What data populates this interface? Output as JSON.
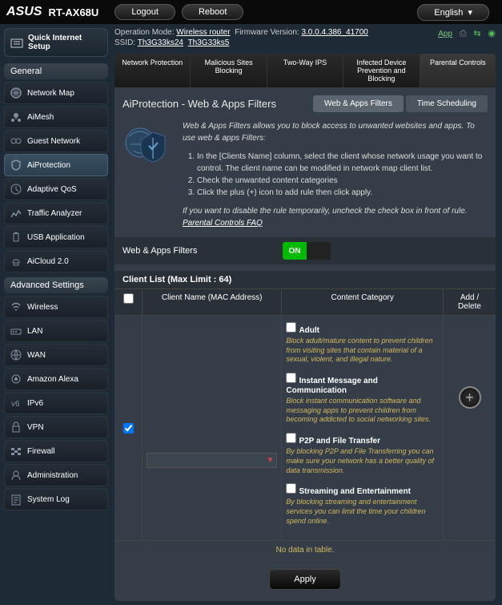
{
  "brand": "ASUS",
  "model": "RT-AX68U",
  "top_buttons": {
    "logout": "Logout",
    "reboot": "Reboot",
    "language": "English"
  },
  "info": {
    "op_mode_label": "Operation Mode:",
    "op_mode_value": "Wireless router",
    "fw_label": "Firmware Version:",
    "fw_value": "3.0.0.4.386_41700",
    "ssid_label": "SSID:",
    "ssid1": "Th3G33ks24",
    "ssid2": "Th3G33ks5",
    "app": "App"
  },
  "qis": "Quick Internet Setup",
  "sections": {
    "general": "General",
    "advanced": "Advanced Settings"
  },
  "menu_general": [
    "Network Map",
    "AiMesh",
    "Guest Network",
    "AiProtection",
    "Adaptive QoS",
    "Traffic Analyzer",
    "USB Application",
    "AiCloud 2.0"
  ],
  "menu_advanced": [
    "Wireless",
    "LAN",
    "WAN",
    "Amazon Alexa",
    "IPv6",
    "VPN",
    "Firewall",
    "Administration",
    "System Log"
  ],
  "tabs": [
    "Network Protection",
    "Malicious Sites Blocking",
    "Two-Way IPS",
    "Infected Device Prevention and Blocking",
    "Parental Controls"
  ],
  "panel": {
    "title": "AiProtection - Web & Apps Filters",
    "subtab1": "Web & Apps Filters",
    "subtab2": "Time Scheduling",
    "intro": "Web & Apps Filters allows you to block access to unwanted websites and apps. To use web & apps Filters:",
    "step1": "In the [Clients Name] column, select the client whose network usage you want to control. The client name can be modified in network map client list.",
    "step2": "Check the unwanted content categories",
    "step3": "Click the plus (+) icon to add rule then click apply.",
    "disable_note": "If you want to disable the rule temporarily, uncheck the check box in front of rule.",
    "faq_link": "Parental Controls FAQ",
    "toggle_label": "Web & Apps Filters",
    "toggle_on": "ON",
    "list_header": "Client List (Max Limit : 64)",
    "col_name": "Client Name (MAC Address)",
    "col_cat": "Content Category",
    "col_act": "Add / Delete",
    "no_data": "No data in table.",
    "apply": "Apply"
  },
  "categories": [
    {
      "name": "Adult",
      "desc": "Block adult/mature content to prevent children from visiting sites that contain material of a sexual, violent, and illegal nature."
    },
    {
      "name": "Instant Message and Communication",
      "desc": "Block instant communication software and messaging apps to prevent children from becoming addicted to social networking sites."
    },
    {
      "name": "P2P and File Transfer",
      "desc": "By blocking P2P and File Transferring you can make sure your network has a better quality of data transmission."
    },
    {
      "name": "Streaming and Entertainment",
      "desc": "By blocking streaming and entertainment services you can limit the time your children spend online."
    }
  ]
}
